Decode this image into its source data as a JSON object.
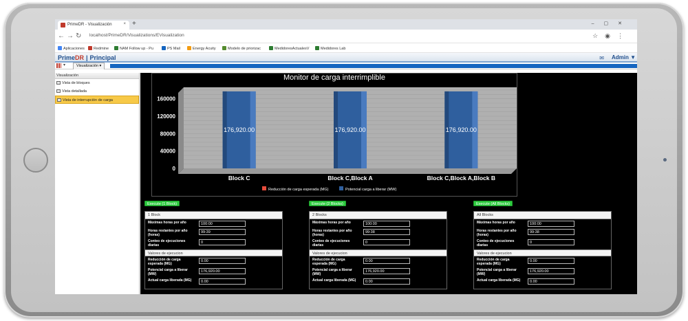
{
  "browser": {
    "tab_title": "PrimeDR - Visualización",
    "tab_close": "×",
    "new_tab": "+",
    "url": "localhost/PrimeDR/Visualizations/EVisualization",
    "bookmarks": [
      {
        "label": "Aplicaciones",
        "color": "#4285f4"
      },
      {
        "label": "Redmine",
        "color": "#c0392b"
      },
      {
        "label": "NAM Follow up - Pu",
        "color": "#2e7d32"
      },
      {
        "label": "PS Mail",
        "color": "#1565c0"
      },
      {
        "label": "Energy Acuity",
        "color": "#f39c12"
      },
      {
        "label": "Modelo de priorizac",
        "color": "#558b2f"
      },
      {
        "label": "MedidoresActualesV",
        "color": "#2e7d32"
      },
      {
        "label": "Medidores Lab",
        "color": "#2e7d32"
      }
    ]
  },
  "app": {
    "brand_prime": "Prime",
    "brand_dr": "DR",
    "brand_sep": "|",
    "brand_section": "Principal",
    "user": "Admin ▼",
    "toolbar_tab": "Visualización"
  },
  "sidebar": {
    "header": "Visualización",
    "items": [
      {
        "label": "Vista de bloques"
      },
      {
        "label": "Vista detallada"
      },
      {
        "label": "Vista de interrupción de carga"
      }
    ]
  },
  "chart_data": {
    "type": "bar",
    "title": "Monitor de carga interrimplible",
    "categories": [
      "Block C",
      "Block C,Block A",
      "Block C,Block A,Block B"
    ],
    "series": [
      {
        "name": "Reducción de carga esperada (MG)",
        "values": [
          0,
          0,
          0
        ],
        "color": "#e74c3c"
      },
      {
        "name": "Potencial carga a liberar (MW)",
        "values": [
          176920,
          176920,
          176920
        ],
        "color": "#2f5f9e"
      }
    ],
    "data_labels": [
      "176,920.00",
      "176,920.00",
      "176,920.00"
    ],
    "yticks": [
      0,
      40000,
      80000,
      120000,
      160000
    ],
    "ylim": [
      0,
      180000
    ],
    "grid": true,
    "legend": "bottom"
  },
  "panels": [
    {
      "button": "Execute (1 Block)",
      "header": "1 Block",
      "max_hours_label": "Máximas horas por año",
      "max_hours": "100:00",
      "remaining_label": "Horas restantes por año (horas)",
      "remaining": "99:39",
      "count_label": "Conteo de ejecuciones diarias",
      "count": "0",
      "exec_header": "Valores de ejecucion",
      "reduction_label": "Reducción de carga esperada (MG)",
      "reduction": "0.00",
      "potential_label": "Potencial carga a liberar (MW)",
      "potential": "176,920.00",
      "actual_label": "Actual carga liberada (MG)",
      "actual": "0.00"
    },
    {
      "button": "Execute (2 Blocks)",
      "header": "2 Blocks",
      "max_hours_label": "Máximas horas por año",
      "max_hours": "100:00",
      "remaining_label": "Horas restantes por año (horas)",
      "remaining": "99:38",
      "count_label": "Conteo de ejecuciones diarias",
      "count": "0",
      "exec_header": "Valores de ejecucion",
      "reduction_label": "Reducción de carga esperada (MG)",
      "reduction": "0.00",
      "potential_label": "Potencial carga a liberar (MW)",
      "potential": "176,920.00",
      "actual_label": "Actual carga liberada (MG)",
      "actual": "0.00"
    },
    {
      "button": "Execute (All Blocks)",
      "header": "All Blocks",
      "max_hours_label": "Máximas horas por año",
      "max_hours": "100:00",
      "remaining_label": "Horas restantes por año (horas)",
      "remaining": "99:38",
      "count_label": "Conteo de ejecuciones diarias",
      "count": "0",
      "exec_header": "Valores de ejecucion",
      "reduction_label": "Reducción de carga esperada (MG)",
      "reduction": "0.00",
      "potential_label": "Potencial carga a liberar (MW)",
      "potential": "176,920.00",
      "actual_label": "Actual carga liberada (MG)",
      "actual": "0.00"
    }
  ]
}
